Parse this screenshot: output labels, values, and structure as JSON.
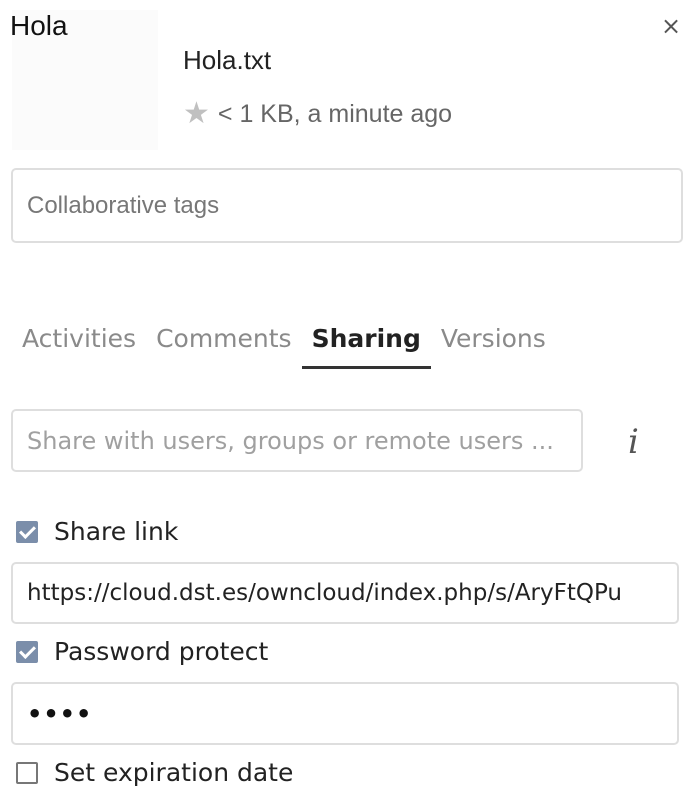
{
  "header": {
    "title": "Hola",
    "close_icon": "×"
  },
  "file": {
    "name": "Hola.txt",
    "star_icon": "★",
    "meta": "< 1 KB, a minute ago"
  },
  "tags": {
    "placeholder": "Collaborative tags"
  },
  "tabs": [
    {
      "label": "Activities",
      "active": false
    },
    {
      "label": "Comments",
      "active": false
    },
    {
      "label": "Sharing",
      "active": true
    },
    {
      "label": "Versions",
      "active": false
    }
  ],
  "sharing": {
    "share_placeholder": "Share with users, groups or remote users ...",
    "info_icon": "i",
    "share_link_label": "Share link",
    "share_link_checked": true,
    "link_value": "https://cloud.dst.es/owncloud/index.php/s/AryFtQPu",
    "password_label": "Password protect",
    "password_checked": true,
    "password_value": "••••",
    "expiration_label": "Set expiration date",
    "expiration_checked": false
  },
  "colors": {
    "checkbox_checked": "#7b8eaa",
    "active_tab_underline": "#333333"
  }
}
